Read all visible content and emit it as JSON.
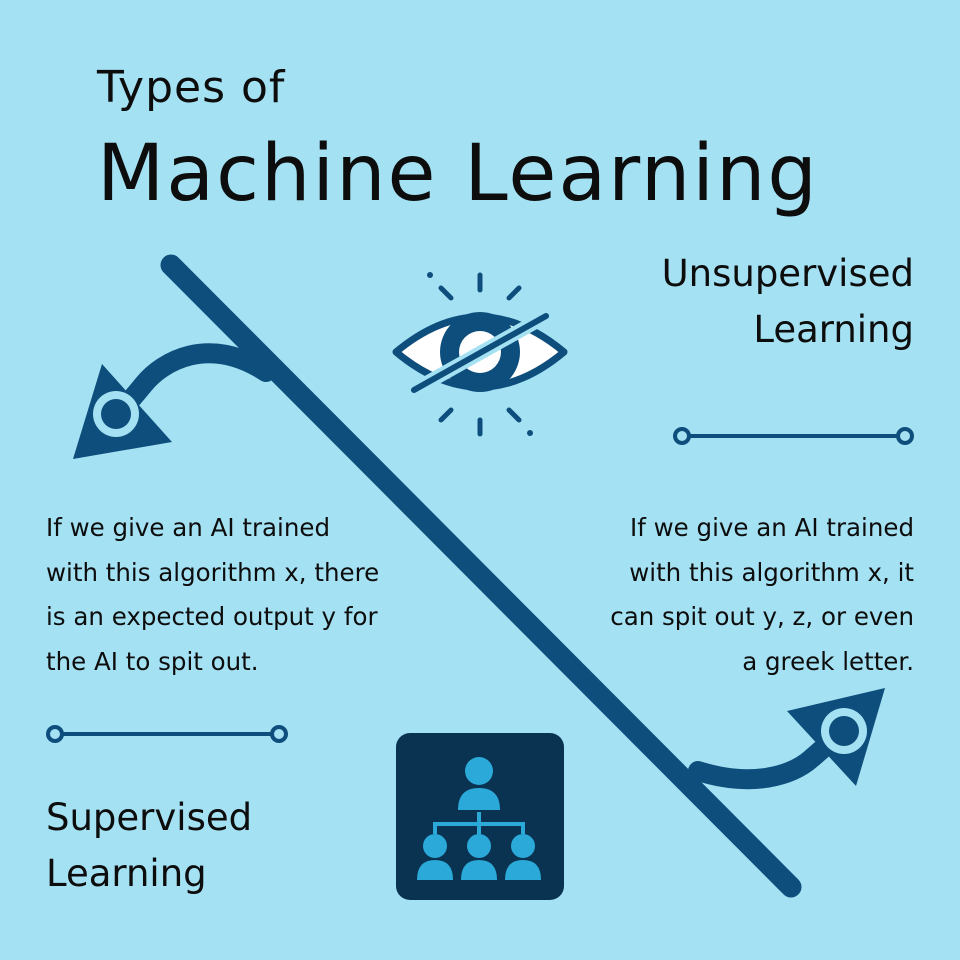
{
  "header": {
    "subtitle": "Types of",
    "title": "Machine Learning"
  },
  "unsupervised": {
    "heading_line1": "Unsupervised",
    "heading_line2": "Learning",
    "description": [
      "If we give an AI trained",
      "with this algorithm x, it",
      "can spit out y, z, or even",
      "a greek letter."
    ],
    "icon": "crossed-eye-icon"
  },
  "supervised": {
    "heading_line1": "Supervised",
    "heading_line2": "Learning",
    "description": [
      "If we give an AI trained",
      "with this algorithm x, there",
      "is an expected output y for",
      "the AI to spit out."
    ],
    "icon": "hierarchy-people-icon"
  },
  "colors": {
    "background": "#a4e1f3",
    "dark_blue": "#0e4e7c",
    "navy": "#08324f",
    "icon_tile": "#0a3352",
    "icon_figure": "#2ba9d9",
    "text": "#0d0d0d"
  }
}
